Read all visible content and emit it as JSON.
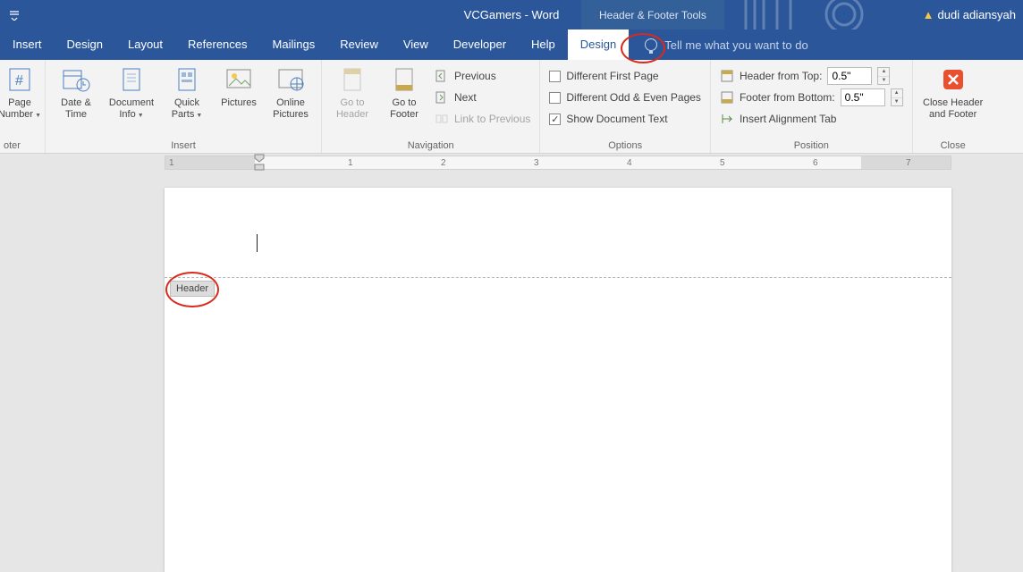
{
  "title": "VCGamers  -  Word",
  "context_tab": "Header & Footer Tools",
  "user": "dudi adiansyah",
  "tabs": [
    "Insert",
    "Design",
    "Layout",
    "References",
    "Mailings",
    "Review",
    "View",
    "Developer",
    "Help",
    "Design"
  ],
  "active_tab_index": 9,
  "tellme": "Tell me what you want to do",
  "ribbon": {
    "groups": {
      "hf_partial": {
        "page_number": "Page Number",
        "date_time": "Date & Time",
        "doc_info": "Document Info",
        "quick_parts": "Quick Parts",
        "pictures": "Pictures",
        "online_pictures": "Online Pictures",
        "label": "Insert"
      },
      "nav": {
        "go_header": "Go to Header",
        "go_footer": "Go to Footer",
        "previous": "Previous",
        "next": "Next",
        "link_prev": "Link to Previous",
        "label": "Navigation"
      },
      "options": {
        "diff_first": "Different First Page",
        "diff_odd": "Different Odd & Even Pages",
        "show_doc": "Show Document Text",
        "label": "Options"
      },
      "position": {
        "from_top": "Header from Top:",
        "from_bottom": "Footer from Bottom:",
        "top_val": "0.5\"",
        "bottom_val": "0.5\"",
        "align_tab": "Insert Alignment Tab",
        "label": "Position"
      },
      "close": {
        "btn": "Close Header and Footer",
        "label": "Close"
      }
    },
    "truncated_left": "oter"
  },
  "ruler_numbers": [
    "1",
    "1",
    "2",
    "3",
    "4",
    "5",
    "6",
    "7"
  ],
  "page": {
    "header_tag": "Header"
  },
  "checks": {
    "diff_first": false,
    "diff_odd": false,
    "show_doc": true
  }
}
